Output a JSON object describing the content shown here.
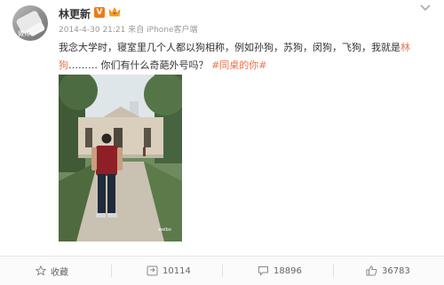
{
  "post": {
    "author": "林更新",
    "verified_badge": "V",
    "meta_date": "2014-4-30 21:21",
    "meta_from": "来自",
    "meta_source": "iPhone客户端",
    "avatar_watermark": "微博",
    "text_part1": "我念大学时，寝室里几个人都以狗相称，例如孙狗，苏狗，闵狗，飞狗，我就是",
    "text_mention": "林狗",
    "text_part2": "……… 你们有什么奇葩外号吗？ ",
    "text_topic": "#同桌的你#",
    "photo_watermark": "新浪微博 weibo.com/u/"
  },
  "actions": {
    "favorite_label": "收藏",
    "repost_count": "10114",
    "comment_count": "18896",
    "like_count": "36783"
  },
  "icons": {
    "favorite": "star-icon",
    "repost": "repost-icon",
    "comment": "comment-icon",
    "like": "thumbs-up-icon",
    "menu": "chevron-down-icon",
    "member": "crown-icon"
  },
  "colors": {
    "accent": "#eb7350",
    "verified": "#ef7b19",
    "meta": "#999999"
  }
}
